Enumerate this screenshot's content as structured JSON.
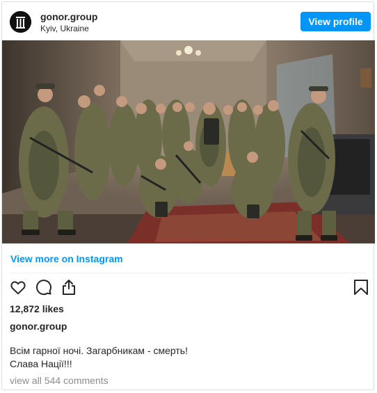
{
  "post": {
    "username": "gonor.group",
    "location": "Kyiv, Ukraine",
    "view_profile_label": "View profile",
    "view_more_label": "View more on Instagram",
    "likes": "12,872 likes",
    "caption_username": "gonor.group",
    "caption_text": "Всім гарної ночі. Загарбникам - смерть!\nСлава Нації!!!",
    "comments_link": "view all 544 comments"
  },
  "icons": {
    "like": "heart-icon",
    "comment": "comment-icon",
    "share": "share-icon",
    "save": "bookmark-icon",
    "avatar": "gonor-logo"
  },
  "colors": {
    "accent": "#0095f6",
    "text": "#262626",
    "muted": "#8e8e8e",
    "border": "#dbdbdb"
  }
}
